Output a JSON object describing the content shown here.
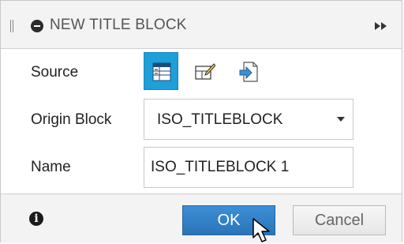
{
  "dialog": {
    "title": "NEW TITLE BLOCK",
    "header_icons": {
      "grip": "drag-handle-icon",
      "collapse": "minus-circle-icon",
      "expand": "double-chevron-right-icon"
    }
  },
  "source": {
    "label": "Source",
    "options": [
      {
        "icon": "table-icon",
        "selected": true
      },
      {
        "icon": "edit-block-icon",
        "selected": false
      },
      {
        "icon": "import-file-icon",
        "selected": false
      }
    ]
  },
  "origin_block": {
    "label": "Origin Block",
    "value": "ISO_TITLEBLOCK"
  },
  "name": {
    "label": "Name",
    "value": "ISO_TITLEBLOCK 1"
  },
  "footer": {
    "info_icon": "info-icon",
    "ok_label": "OK",
    "cancel_label": "Cancel"
  },
  "colors": {
    "accent": "#1e9fd8",
    "ok_button": "#2a74b8"
  }
}
